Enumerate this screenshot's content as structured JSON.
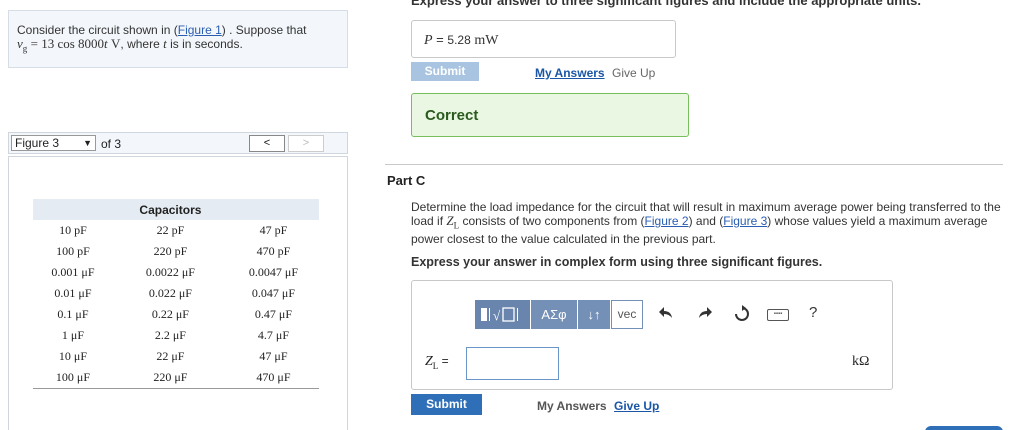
{
  "problem": {
    "text_1": "Consider the circuit shown in (",
    "figure_link": "Figure 1",
    "text_2": ") . Suppose that",
    "vg_var": "v",
    "vg_sub": "g",
    "vg_expr": "= 13 cos 8000",
    "t_var": "t",
    "vg_unit": "V",
    "text_3": ", where",
    "text_4": "is in seconds."
  },
  "figure_nav": {
    "selected": "Figure 3",
    "of_text": "of 3",
    "prev_label": "<",
    "next_label": ">"
  },
  "capacitor_table": {
    "header": "Capacitors",
    "rows": [
      [
        "10 pF",
        "22 pF",
        "47 pF"
      ],
      [
        "100 pF",
        "220 pF",
        "470 pF"
      ],
      [
        "0.001 μF",
        "0.0022 μF",
        "0.0047 μF"
      ],
      [
        "0.01 μF",
        "0.022 μF",
        "0.047 μF"
      ],
      [
        "0.1 μF",
        "0.22 μF",
        "0.47 μF"
      ],
      [
        "1 μF",
        "2.2 μF",
        "4.7 μF"
      ],
      [
        "10 μF",
        "22 μF",
        "47 μF"
      ],
      [
        "100 μF",
        "220 μF",
        "470 μF"
      ]
    ]
  },
  "part_b": {
    "instruction": "Express your answer to three significant figures and include the appropriate units.",
    "answer_var": "P",
    "answer_eq": " = ",
    "answer_value": "5.28",
    "answer_unit": "mW",
    "submit_label": "Submit",
    "my_answers_label": "My Answers",
    "give_up_label": "Give Up",
    "feedback": "Correct"
  },
  "part_c": {
    "title": "Part C",
    "desc_1": "Determine the load impedance for the circuit that will result in maximum average power being transferred to the load if",
    "zl_var": "Z",
    "zl_sub": "L",
    "desc_2": "consists of two components from (",
    "fig2_link": "Figure 2",
    "desc_3": ") and (",
    "fig3_link": "Figure 3",
    "desc_4": ") whose values yield a maximum average power closest to the value calculated in the previous part.",
    "instruction": "Express your answer in complex form using three significant figures.",
    "toolbar": {
      "greek_label": "ΑΣφ",
      "arrows_label": "↓↑",
      "vec_label": "vec",
      "help_label": "?"
    },
    "input_label_var": "Z",
    "input_label_sub": "L",
    "input_label_eq": " =",
    "input_value": "",
    "unit": "kΩ",
    "submit_label": "Submit",
    "my_answers_label": "My Answers",
    "give_up_label": "Give Up"
  },
  "colors": {
    "link": "#2a5db0",
    "submit_active": "#2f6fb8",
    "submit_disabled": "#a9c4e0",
    "correct_bg": "#eaf7e2",
    "correct_border": "#77bf5c",
    "toolbar": "#7590b7"
  }
}
